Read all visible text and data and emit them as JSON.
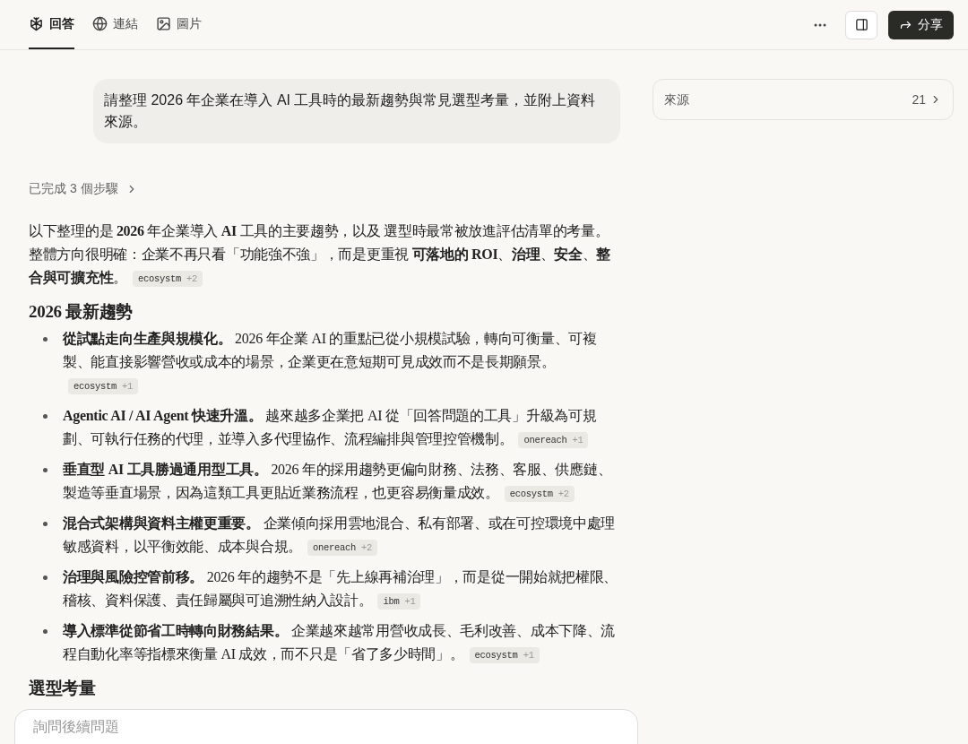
{
  "tabs": [
    {
      "label": "回答",
      "kind": "answer",
      "selected": true
    },
    {
      "label": "連結",
      "kind": "links",
      "selected": false
    },
    {
      "label": "圖片",
      "kind": "images",
      "selected": false
    }
  ],
  "header": {
    "share_label": "分享"
  },
  "query": "請整理 2026 年企業在導入 AI 工具時的最新趨勢與常見選型考量，並附上資料來源。",
  "steps": "已完成 3 個步驟",
  "intro": {
    "text": "以下整理的是 **2026** 年企業導入 **AI** 工具的主要趨勢，以及 選型時最常被放進評估清單的考量。整體方向很明確：企業不再只看「功能強不強」，而是更重視 **可落地的 ROI**、**治理**、**安全**、**整合與可擴充性**。",
    "citation": {
      "source": "ecosystm",
      "more": "+2"
    }
  },
  "sections": [
    {
      "heading": "2026 最新趨勢",
      "items": [
        {
          "text": "**從試點走向生產與規模化。** 2026 年企業 AI 的重點已從小規模試驗，轉向可衡量、可複製、能直接影響營收或成本的場景，企業更在意短期可見成效而不是長期願景。",
          "citation": {
            "source": "ecosystm",
            "more": "+1"
          }
        },
        {
          "text": "**Agentic AI / AI Agent 快速升溫。** 越來越多企業把 AI 從「回答問題的工具」升級為可規劃、可執行任務的代理，並導入多代理協作、流程編排與管理控管機制。",
          "citation": {
            "source": "onereach",
            "more": "+1"
          }
        },
        {
          "text": "**垂直型 AI 工具勝過通用型工具。** 2026 年的採用趨勢更偏向財務、法務、客服、供應鏈、製造等垂直場景，因為這類工具更貼近業務流程，也更容易衡量成效。",
          "citation": {
            "source": "ecosystm",
            "more": "+2"
          }
        },
        {
          "text": "**混合式架構與資料主權更重要。** 企業傾向採用雲地混合、私有部署、或在可控環境中處理敏感資料，以平衡效能、成本與合規。",
          "citation": {
            "source": "onereach",
            "more": "+2"
          }
        },
        {
          "text": "**治理與風險控管前移。** 2026 年的趨勢不是「先上線再補治理」，而是從一開始就把權限、稽核、資料保護、責任歸屬與可追溯性納入設計。",
          "citation": {
            "source": "ibm",
            "more": "+1"
          }
        },
        {
          "text": "**導入標準從節省工時轉向財務結果。** 企業越來越常用營收成長、毛利改善、成本下降、流程自動化率等指標來衡量 AI 成效，而不只是「省了多少時間」。",
          "citation": {
            "source": "ecosystm",
            "more": "+1"
          }
        }
      ]
    },
    {
      "heading": "選型考量"
    }
  ],
  "sources": {
    "label": "來源",
    "count": "21"
  },
  "followup": {
    "placeholder": "詢問後續問題"
  }
}
